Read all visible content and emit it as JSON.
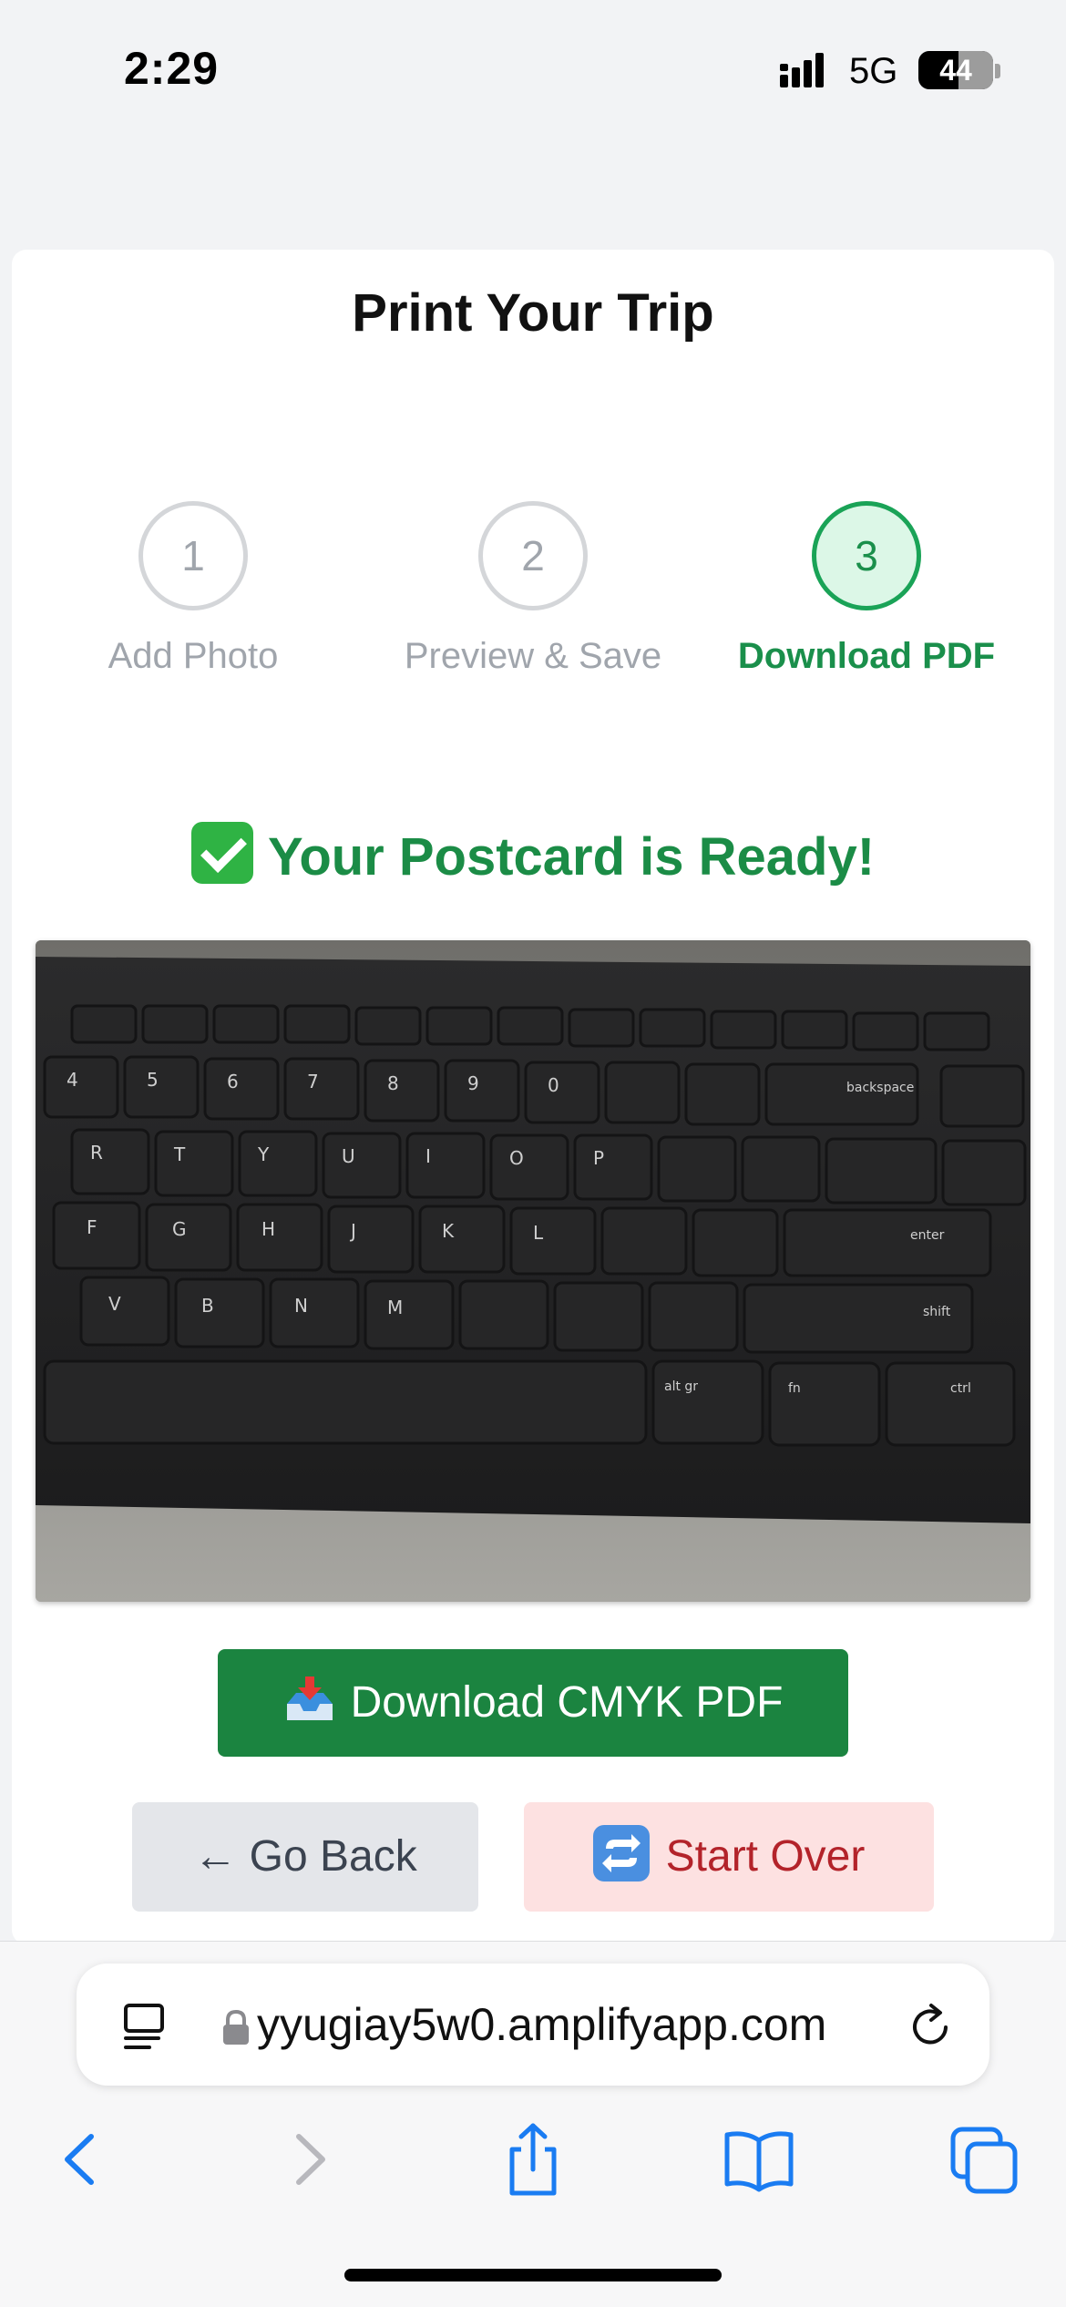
{
  "status_bar": {
    "time": "2:29",
    "network": "5G",
    "battery": "44"
  },
  "page": {
    "title": "Print Your Trip"
  },
  "steps": [
    {
      "number": "1",
      "label": "Add Photo",
      "active": false
    },
    {
      "number": "2",
      "label": "Preview & Save",
      "active": false
    },
    {
      "number": "3",
      "label": "Download PDF",
      "active": true
    }
  ],
  "ready_message": "Your Postcard is Ready!",
  "buttons": {
    "download": "Download CMYK PDF",
    "back": "← Go Back",
    "start_over": "Start Over"
  },
  "browser": {
    "url": "​yyugiay5w0.amplifyapp.com"
  },
  "icons": {
    "check": "check-mark-button-emoji",
    "download": "inbox-tray-emoji",
    "start_over": "repeat-emoji",
    "reader": "reader-mode-icon",
    "lock": "lock-icon",
    "reload": "reload-icon",
    "back": "chevron-left-icon",
    "forward": "chevron-right-icon",
    "share": "share-icon",
    "bookmarks": "book-icon",
    "tabs": "tabs-icon"
  },
  "colors": {
    "accent_green": "#1b8440",
    "ready_green": "#1b8c46",
    "start_over_bg": "#fde1e1",
    "start_over_text": "#b3232a",
    "ios_blue": "#1a7cf2"
  }
}
